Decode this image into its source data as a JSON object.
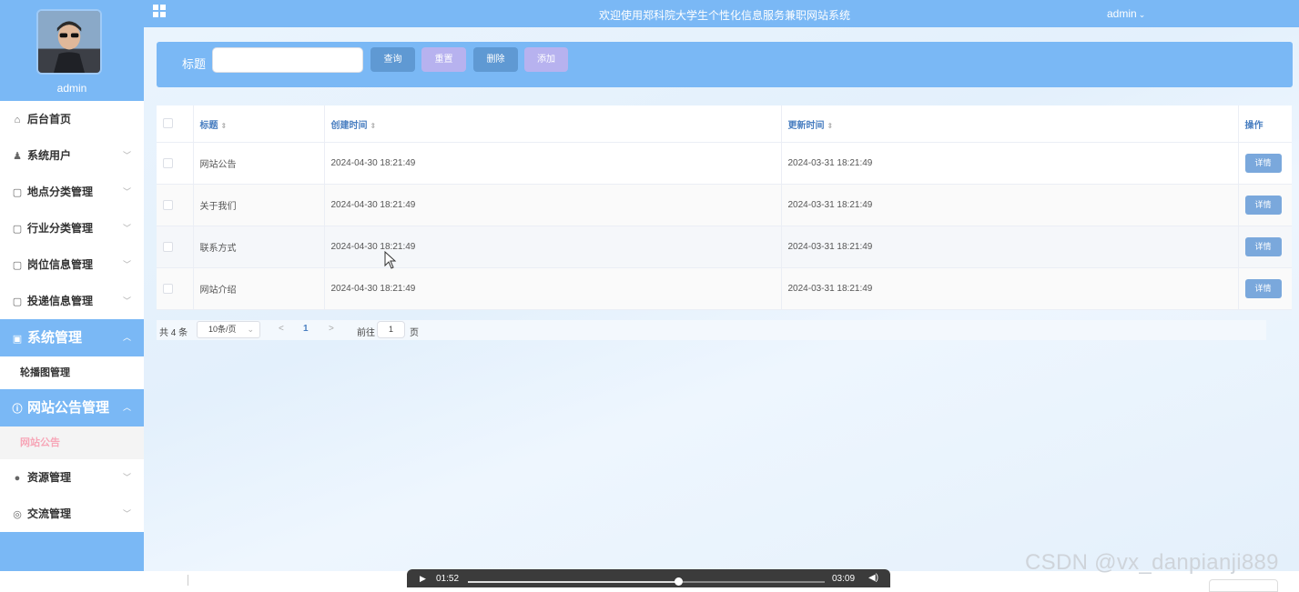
{
  "sidebar": {
    "username": "admin",
    "menu": [
      {
        "label": "后台首页",
        "icon": "home-icon",
        "glyph": "⌂"
      },
      {
        "label": "系统用户",
        "icon": "user-icon",
        "glyph": "♟"
      },
      {
        "label": "地点分类管理",
        "icon": "doc-icon",
        "glyph": "▢"
      },
      {
        "label": "行业分类管理",
        "icon": "doc-icon",
        "glyph": "▢"
      },
      {
        "label": "岗位信息管理",
        "icon": "doc-icon",
        "glyph": "▢"
      },
      {
        "label": "投递信息管理",
        "icon": "doc-icon",
        "glyph": "▢"
      }
    ],
    "group_system": {
      "label": "系统管理",
      "glyph": "▣"
    },
    "sub_carousel": "轮播图管理",
    "group_notice": {
      "label": "网站公告管理",
      "glyph": "ⓘ"
    },
    "sub_notice": "网站公告",
    "menu_resource": {
      "label": "资源管理",
      "glyph": "●"
    },
    "menu_exchange": {
      "label": "交流管理",
      "glyph": "◎"
    }
  },
  "topbar": {
    "title": "欢迎使用郑科院大学生个性化信息服务兼职网站系统",
    "user": "admin",
    "user_caret": "⌄"
  },
  "search": {
    "label": "标题",
    "placeholder": "",
    "query": "查询",
    "reset": "重置",
    "delete": "删除",
    "add": "添加"
  },
  "table": {
    "headers": {
      "title": "标题",
      "created": "创建时间",
      "updated": "更新时间",
      "ops": "操作"
    },
    "sort_glyph": "⇕",
    "rows": [
      {
        "title": "网站公告",
        "created": "2024-04-30 18:21:49",
        "updated": "2024-03-31 18:21:49",
        "action": "详情"
      },
      {
        "title": "关于我们",
        "created": "2024-04-30 18:21:49",
        "updated": "2024-03-31 18:21:49",
        "action": "详情"
      },
      {
        "title": "联系方式",
        "created": "2024-04-30 18:21:49",
        "updated": "2024-03-31 18:21:49",
        "action": "详情"
      },
      {
        "title": "网站介绍",
        "created": "2024-04-30 18:21:49",
        "updated": "2024-03-31 18:21:49",
        "action": "详情"
      }
    ]
  },
  "pager": {
    "total": "共 4 条",
    "size": "10条/页",
    "prev": "<",
    "page": "1",
    "next": ">",
    "goto": "前往",
    "goto_value": "1",
    "page_unit": "页"
  },
  "video": {
    "current": "01:52",
    "duration": "03:09",
    "progress": 0.59
  },
  "watermark": "CSDN @vx_danpianji889",
  "colors": {
    "accent": "#7ab8f5",
    "button_blue": "#5f99d3",
    "button_purple": "#b7b2ef",
    "active_pink": "#f7a7b8"
  }
}
